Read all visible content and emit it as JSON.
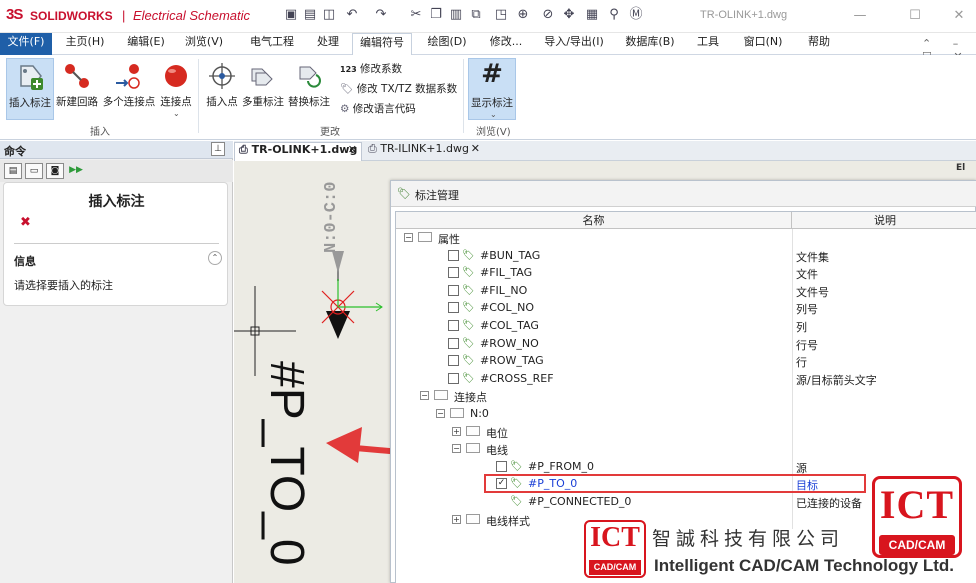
{
  "app": {
    "logo_mark": "3S",
    "brand": "SOLIDWORKS",
    "separator": "|",
    "product": "Electrical Schematic",
    "doc_title": "TR-OLINK+1.dwg",
    "quick_access_icons": [
      "open-icon",
      "save-icon",
      "save-all-icon",
      "undo-icon",
      "redo-icon",
      "cut-icon",
      "copy-icon",
      "paste-icon",
      "copy-special-icon",
      "copy-format-icon",
      "zoom-icon",
      "zoom-window-icon",
      "pan-icon",
      "regen-icon",
      "search-icon",
      "help-icon"
    ],
    "window_buttons": {
      "minimize": "—",
      "maximize": "☐",
      "close": "✕"
    }
  },
  "menu": [
    {
      "label": "文件(F)",
      "active": false
    },
    {
      "label": "主页(H)"
    },
    {
      "label": "编辑(E)"
    },
    {
      "label": "浏览(V)"
    },
    {
      "label": "电气工程"
    },
    {
      "label": "处理"
    },
    {
      "label": "编辑符号",
      "active": true
    },
    {
      "label": "绘图(D)"
    },
    {
      "label": "修改..."
    },
    {
      "label": "导入/导出(I)"
    },
    {
      "label": "数据库(B)"
    },
    {
      "label": "工具"
    },
    {
      "label": "窗口(N)"
    },
    {
      "label": "帮助"
    }
  ],
  "menu_right": "⌃ – ☐ ✕",
  "ribbon": {
    "insert_tag": "插入标注",
    "new_circuit": "新建回路",
    "multi_points": "多个连接点",
    "connection_point": "连接点",
    "insert_point": "插入点",
    "multi_tag": "多重标注",
    "replace_tag": "替换标注",
    "modify_coeff": "修改系数",
    "modify_coeff_prefix": "123",
    "modify_txtz": "修改 TX/TZ 数据系数",
    "modify_lang": "修改语言代码",
    "show_tags": "显示标注",
    "group_insert": "插入",
    "group_modify": "更改",
    "group_browse": "浏览(V)"
  },
  "left_panel": {
    "title": "命令",
    "pin": "📌",
    "card_title": "插入标注",
    "cancel": "✖",
    "info_label": "信息",
    "collapse": "⌃",
    "message": "请选择要插入的标注"
  },
  "doc_tabs": [
    {
      "label": "TR-OLINK+1.dwg",
      "close": "✕",
      "active": true
    },
    {
      "label": "TR-ILINK+1.dwg",
      "close": "✕",
      "active": false
    }
  ],
  "tab_nav": "◂ ▸ ✕",
  "canvas": {
    "vertical_text": "N:0-C:0",
    "big_text": "#P_TO_0",
    "side_label": "El"
  },
  "dialog": {
    "title": "标注管理",
    "col_name": "名称",
    "col_desc": "说明",
    "rows": [
      {
        "level": 0,
        "type": "folder",
        "expand": "⊟",
        "name": "属性",
        "desc": ""
      },
      {
        "level": 1,
        "type": "tag",
        "checked": false,
        "name": "#BUN_TAG",
        "desc": "文件集"
      },
      {
        "level": 1,
        "type": "tag",
        "checked": false,
        "name": "#FIL_TAG",
        "desc": "文件"
      },
      {
        "level": 1,
        "type": "tag",
        "checked": false,
        "name": "#FIL_NO",
        "desc": "文件号"
      },
      {
        "level": 1,
        "type": "tag",
        "checked": false,
        "name": "#COL_NO",
        "desc": "列号"
      },
      {
        "level": 1,
        "type": "tag",
        "checked": false,
        "name": "#COL_TAG",
        "desc": "列"
      },
      {
        "level": 1,
        "type": "tag",
        "checked": false,
        "name": "#ROW_NO",
        "desc": "行号"
      },
      {
        "level": 1,
        "type": "tag",
        "checked": false,
        "name": "#ROW_TAG",
        "desc": "行"
      },
      {
        "level": 1,
        "type": "tag",
        "checked": false,
        "name": "#CROSS_REF",
        "desc": "源/目标箭头文字"
      },
      {
        "level": 1,
        "type": "folder",
        "expand": "⊟",
        "name": "连接点",
        "desc": ""
      },
      {
        "level": 2,
        "type": "folder",
        "expand": "⊟",
        "name": "N:0",
        "desc": ""
      },
      {
        "level": 3,
        "type": "folder",
        "expand": "⊞",
        "name": "电位",
        "desc": ""
      },
      {
        "level": 3,
        "type": "folder",
        "expand": "⊟",
        "name": "电线",
        "desc": ""
      },
      {
        "level": 4,
        "type": "tag",
        "checked": false,
        "name": "#P_FROM_0",
        "desc": "源"
      },
      {
        "level": 4,
        "type": "tag",
        "checked": true,
        "highlight": true,
        "name": "#P_TO_0",
        "desc": "目标"
      },
      {
        "level": 4,
        "type": "tag",
        "nocheck": true,
        "name": "#P_CONNECTED_0",
        "desc": "已连接的设备"
      },
      {
        "level": 3,
        "type": "folder",
        "expand": "⊞",
        "name": "电线样式",
        "desc": ""
      }
    ]
  },
  "watermark": {
    "ict": "ICT",
    "cadcam": "CAD/CAM",
    "company_cn": "智誠科技有限公司",
    "company_en": "Intelligent CAD/CAM Technology Ltd."
  },
  "colors": {
    "brand_red": "#c8102e",
    "file_menu_blue": "#1f5fa8",
    "highlight_red": "#e23a3a",
    "tag_green": "#3d8a2c",
    "link_blue": "#1a3fd6"
  }
}
